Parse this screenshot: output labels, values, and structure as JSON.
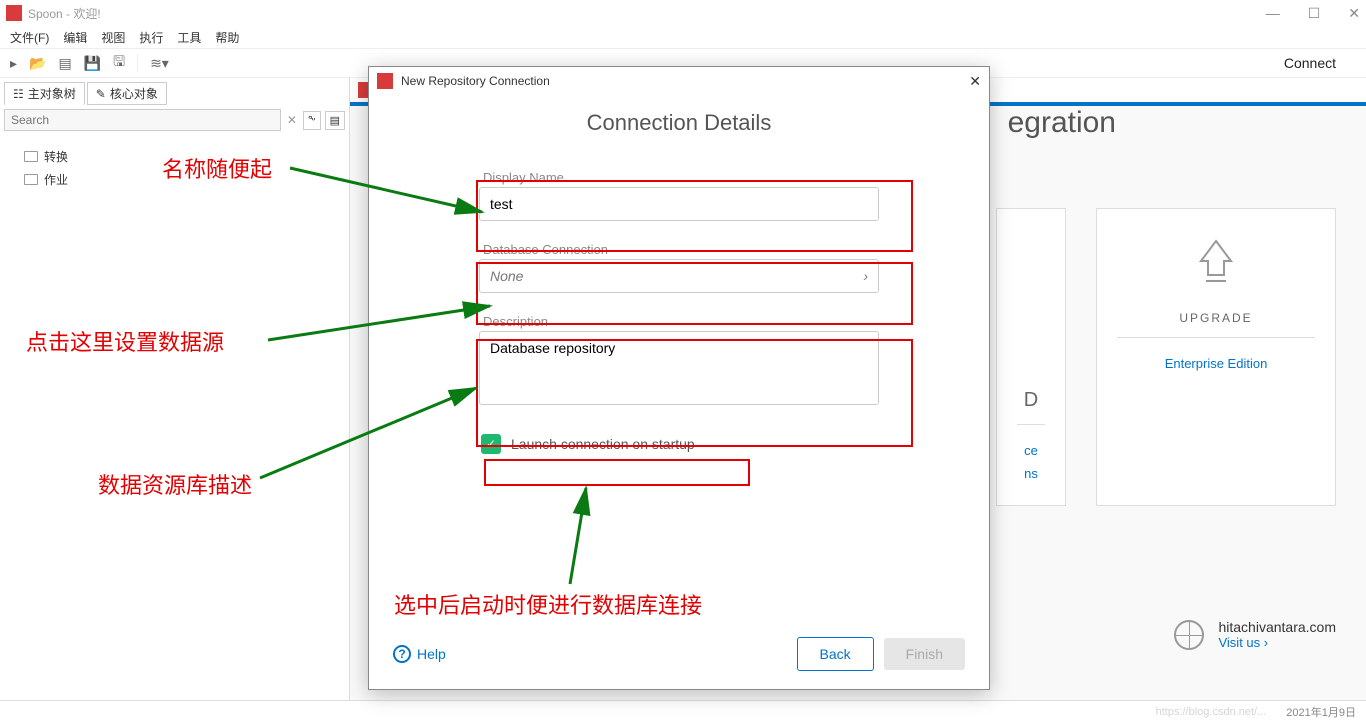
{
  "window": {
    "title": "Spoon - 欢迎!"
  },
  "menu": [
    "文件(F)",
    "编辑",
    "视图",
    "执行",
    "工具",
    "帮助"
  ],
  "toolbar": {
    "connect": "Connect"
  },
  "sidebar": {
    "tabs": [
      {
        "label": "主对象树"
      },
      {
        "label": "核心对象"
      }
    ],
    "search_placeholder": "Search",
    "tree": [
      {
        "label": "转换"
      },
      {
        "label": "作业"
      }
    ]
  },
  "main": {
    "heading_fragment": "egration",
    "upgrade": {
      "title": "UPGRADE",
      "link": "Enterprise Edition"
    },
    "col_left": {
      "links": [
        "ce",
        "ns"
      ],
      "letter": "D"
    },
    "brand": {
      "name": "hitachivantara.com",
      "visit": "Visit us ›"
    }
  },
  "dialog": {
    "wintitle": "New Repository Connection",
    "heading": "Connection Details",
    "display_name_label": "Display Name",
    "display_name_value": "test",
    "db_conn_label": "Database Connection",
    "db_conn_value": "None",
    "desc_label": "Description",
    "desc_value": "Database repository",
    "launch_label": "Launch connection on startup",
    "help": "Help",
    "back": "Back",
    "finish": "Finish"
  },
  "annotations": {
    "a1": "名称随便起",
    "a2": "点击这里设置数据源",
    "a3": "数据资源库描述",
    "a4": "选中后启动时便进行数据库连接"
  },
  "status": {
    "watermark": "https://blog.csdn.net/...",
    "date": "2021年1月9日"
  }
}
